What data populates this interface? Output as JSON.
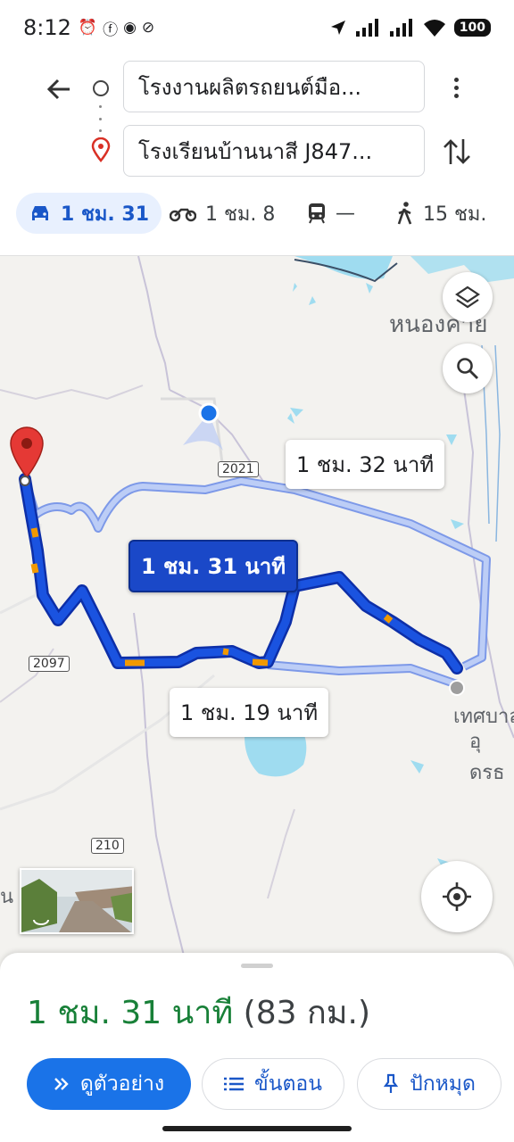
{
  "status_bar": {
    "time": "8:12",
    "battery": "100"
  },
  "directions": {
    "origin": "โรงงานผลิตรถยนต์มือ...",
    "destination": "โรงเรียนบ้านนาสี J847..."
  },
  "modes": [
    {
      "icon": "car-icon",
      "label": "1 ชม. 31",
      "active": true
    },
    {
      "icon": "motorcycle-icon",
      "label": "1 ชม. 8",
      "active": false
    },
    {
      "icon": "transit-icon",
      "label": "—",
      "active": false
    },
    {
      "icon": "walk-icon",
      "label": "15 ชม.",
      "active": false
    }
  ],
  "map": {
    "place_label_top": "หนองคาย",
    "place_label_right_1": "เทศบาล",
    "place_label_right_2": "อุดรธ",
    "place_label_left": "น",
    "road_shields": [
      "2021",
      "2097",
      "210"
    ],
    "route_times": {
      "selected": "1 ชม. 31 นาที",
      "alt_top": "1 ชม. 32 นาที",
      "alt_bottom": "1 ชม. 19 นาที"
    },
    "colors": {
      "primary_route": "#1a53e0",
      "alt_route": "#9bb5f0",
      "traffic_slow": "#f29900",
      "water": "#9fdcf0"
    }
  },
  "summary": {
    "duration": "1 ชม. 31 นาที",
    "distance": "(83 กม.)"
  },
  "actions": {
    "preview": "ดูตัวอย่าง",
    "steps": "ขั้นตอน",
    "pin": "ปักหมุด"
  }
}
